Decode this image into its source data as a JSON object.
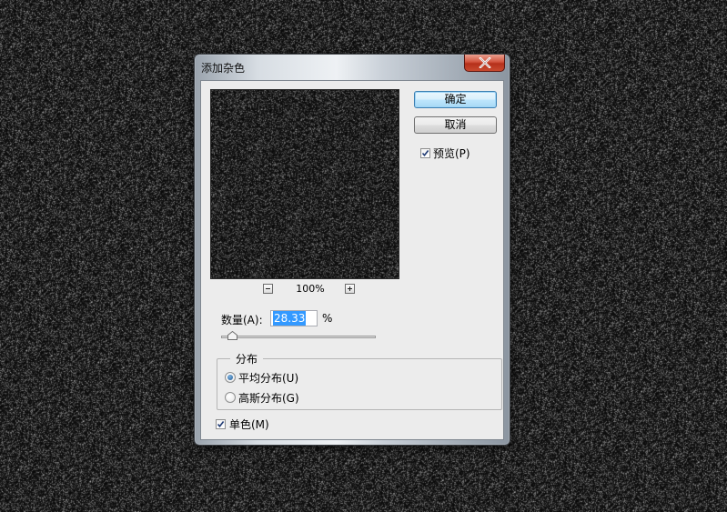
{
  "dialog": {
    "title": "添加杂色",
    "close_icon": "close-icon"
  },
  "preview": {
    "zoom_level": "100%",
    "zoom_out_icon": "minus-icon",
    "zoom_in_icon": "plus-icon"
  },
  "buttons": {
    "ok": "确定",
    "cancel": "取消"
  },
  "preview_checkbox": {
    "label": "预览(P)",
    "checked": true
  },
  "amount": {
    "label": "数量(A):",
    "value": "28.33",
    "unit": "%"
  },
  "distribution": {
    "legend": "分布",
    "options": [
      {
        "label": "平均分布(U)",
        "selected": true
      },
      {
        "label": "高斯分布(G)",
        "selected": false
      }
    ]
  },
  "monochromatic": {
    "label": "单色(M)",
    "checked": true
  },
  "colors": {
    "accent": "#3399ff",
    "close_button": "#c84a30",
    "default_button_border": "#3c7fb1"
  }
}
